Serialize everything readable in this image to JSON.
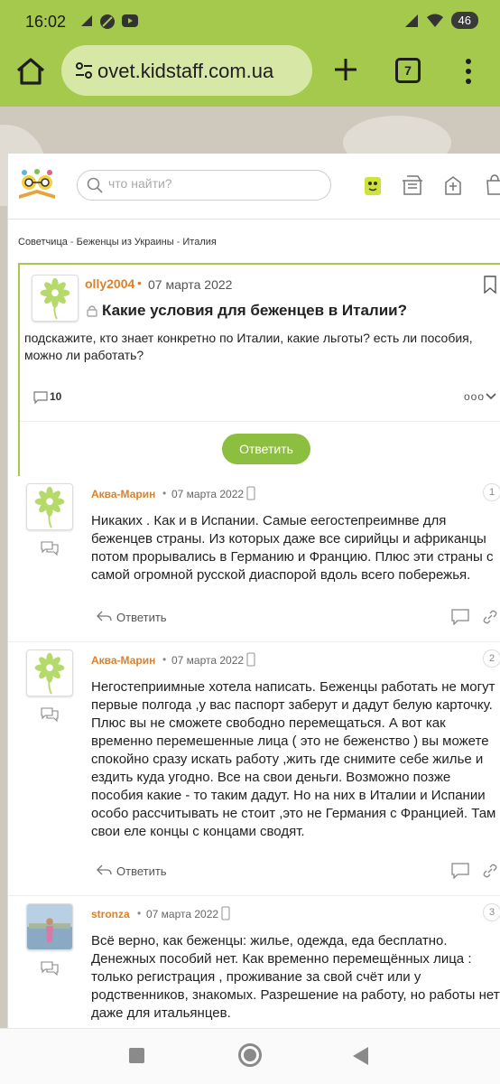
{
  "status_bar": {
    "time": "16:02",
    "battery": "46"
  },
  "browser": {
    "url": "ovet.kidstaff.com.ua",
    "tab_count": "7"
  },
  "site": {
    "search_placeholder": "что найти?",
    "breadcrumbs": [
      "Советчица",
      "Беженцы из Украины",
      "Италия"
    ],
    "breadcrumb_sep": " - "
  },
  "topic": {
    "author": "olly2004",
    "date": "07 марта 2022",
    "title": "Какие условия для беженцев в Италии?",
    "body": "подскажите, кто знает конкретно по Италии, какие льготы? есть ли пособия, можно ли работать?",
    "comments_count": "10",
    "more": "ooo",
    "reply_button": "Ответить"
  },
  "replies": [
    {
      "author": "Аква-Марин",
      "date": "07 марта 2022",
      "number": "1",
      "text": "Никаких . Как и в Испании. Самые еегостепреимнве для беженцев страны. Из которых даже все сирийцы и африканцы потом прорывались в Германию и Францию. Плюс эти страны с самой огромной русской диаспорой вдоль всего побережья.",
      "reply_label": "Ответить"
    },
    {
      "author": "Аква-Марин",
      "date": "07 марта 2022",
      "number": "2",
      "text": "Негостеприимные хотела написать. Беженцы работать не могут первые полгода ,у вас паспорт заберут и дадут белую карточку. Плюс вы не сможете свободно перемещаться. А вот как временно перемешенные лица ( это не беженство ) вы можете спокойно сразу искать работу ,жить где снимите себе жилье и ездить куда угодно. Все на свои деньги. Возможно позже пособия какие - то таким дадут. Но на них в Италии и Испании особо рассчитывать не стоит ,это не Германия с Францией. Там свои еле концы с концами сводят.",
      "reply_label": "Ответить"
    },
    {
      "author": "stronza",
      "date": "07 марта 2022",
      "number": "3",
      "text": "Всё верно, как беженцы: жилье, одежда, еда бесплатно. Денежных пособий нет. Как временно перемещённых лица : только регистрация , проживание за свой счёт или у родственников, знакомых. Разрешение на работу, но работы нет даже для итальянцев."
    }
  ],
  "colors": {
    "accent": "#a4c94c",
    "author": "#d9822b",
    "button": "#8cbf3f"
  }
}
